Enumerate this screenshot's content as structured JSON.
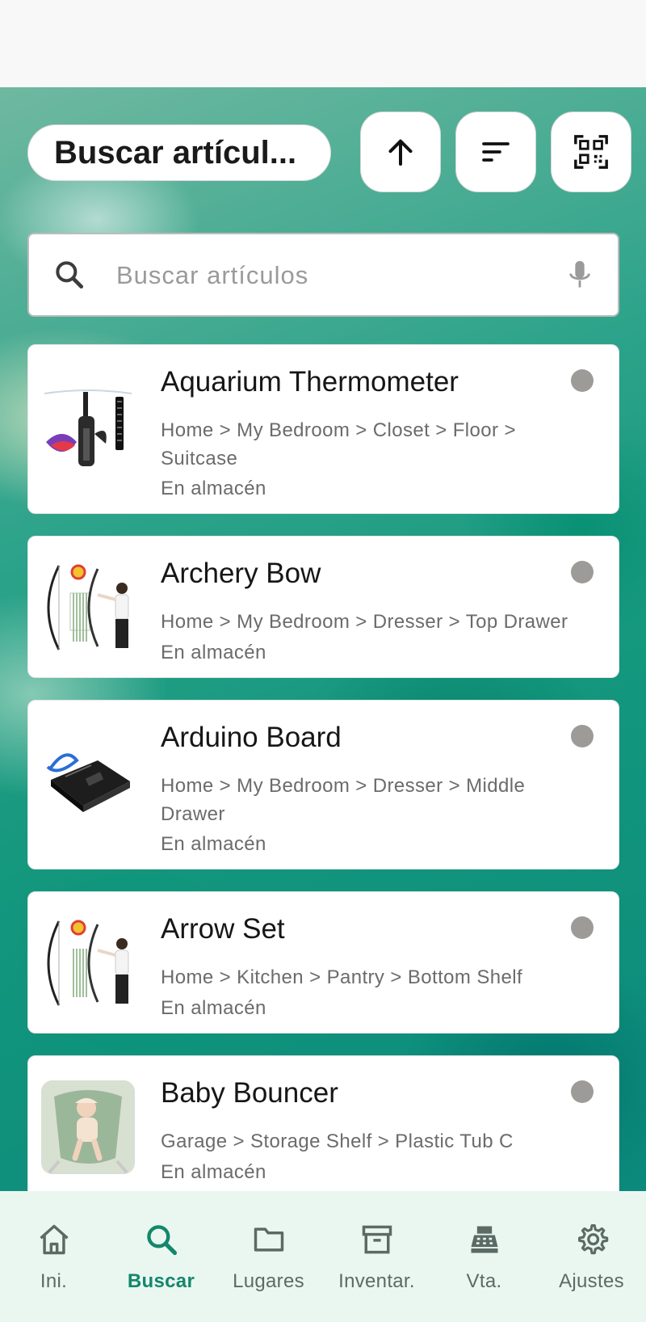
{
  "header": {
    "title": "Buscar artícul...",
    "buttons": [
      {
        "name": "sort-direction-button",
        "icon": "arrow-up-icon"
      },
      {
        "name": "sort-options-button",
        "icon": "sort-icon"
      },
      {
        "name": "qr-scan-button",
        "icon": "qr-code-icon"
      }
    ]
  },
  "search": {
    "placeholder": "Buscar artículos",
    "value": ""
  },
  "items": [
    {
      "name": "Aquarium Thermometer",
      "path": "Home > My Bedroom > Closet > Floor > Suitcase",
      "status": "En almacén"
    },
    {
      "name": "Archery Bow",
      "path": "Home > My Bedroom > Dresser > Top Drawer",
      "status": "En almacén"
    },
    {
      "name": "Arduino Board",
      "path": "Home > My Bedroom > Dresser > Middle Drawer",
      "status": "En almacén"
    },
    {
      "name": "Arrow Set",
      "path": "Home > Kitchen > Pantry > Bottom Shelf",
      "status": "En almacén"
    },
    {
      "name": "Baby Bouncer",
      "path": "Garage > Storage Shelf > Plastic Tub C",
      "status": "En almacén"
    }
  ],
  "nav": [
    {
      "label": "Ini.",
      "icon": "home-icon",
      "active": false
    },
    {
      "label": "Buscar",
      "icon": "search-icon",
      "active": true
    },
    {
      "label": "Lugares",
      "icon": "folder-icon",
      "active": false
    },
    {
      "label": "Inventar.",
      "icon": "archive-icon",
      "active": false
    },
    {
      "label": "Vta.",
      "icon": "cash-register-icon",
      "active": false
    },
    {
      "label": "Ajustes",
      "icon": "settings-gear-icon",
      "active": false
    }
  ],
  "colors": {
    "accent": "#13876b",
    "nav_background": "#eaf7f1",
    "status_dot": "#9d9b97"
  }
}
